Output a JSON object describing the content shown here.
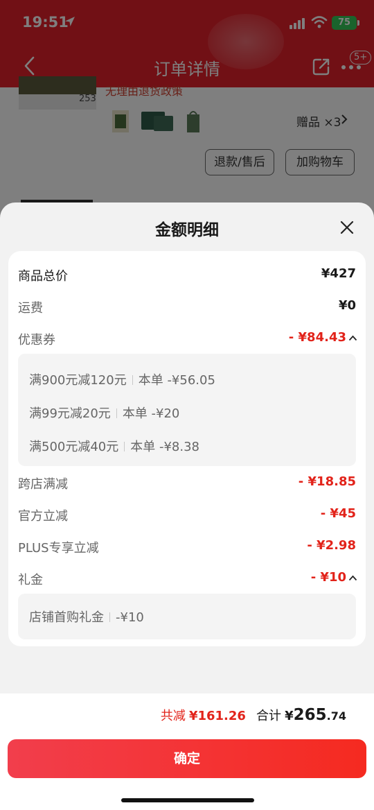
{
  "status_bar": {
    "time": "19:51",
    "battery": "75"
  },
  "nav": {
    "title": "订单详情",
    "more_badge": "5+"
  },
  "background_order": {
    "product_title_partial": "无理由退货政策",
    "thumb_price": "253",
    "gift_count": "赠品 ×3",
    "refund_button": "退款/售后",
    "cart_button": "加购物车"
  },
  "sheet": {
    "title": "金额明细",
    "rows": {
      "total_price": {
        "label": "商品总价",
        "value": "¥427"
      },
      "shipping": {
        "label": "运费",
        "value": "¥0"
      },
      "coupon": {
        "label": "优惠券",
        "value": "- ¥84.43",
        "details": [
          {
            "rule": "满900元减120元",
            "amount": "本单 -¥56.05"
          },
          {
            "rule": "满99元减20元",
            "amount": "本单 -¥20"
          },
          {
            "rule": "满500元减40元",
            "amount": "本单 -¥8.38"
          }
        ]
      },
      "cross_store": {
        "label": "跨店满减",
        "value": "- ¥18.85"
      },
      "official": {
        "label": "官方立减",
        "value": "- ¥45"
      },
      "plus": {
        "label": "PLUS专享立减",
        "value": "- ¥2.98"
      },
      "gift_money": {
        "label": "礼金",
        "value": "- ¥10",
        "details": [
          {
            "rule": "店铺首购礼金",
            "amount": "-¥10"
          }
        ]
      }
    }
  },
  "footer": {
    "reduce_label": "共减",
    "reduce_value": "¥161.26",
    "total_label": "合计",
    "total_symbol": "¥",
    "total_integer": "265",
    "total_decimal": ".74",
    "confirm_label": "确定"
  },
  "colors": {
    "brand_red": "#e3202a",
    "discount_red": "#e2231a",
    "battery_green": "#34c759"
  }
}
